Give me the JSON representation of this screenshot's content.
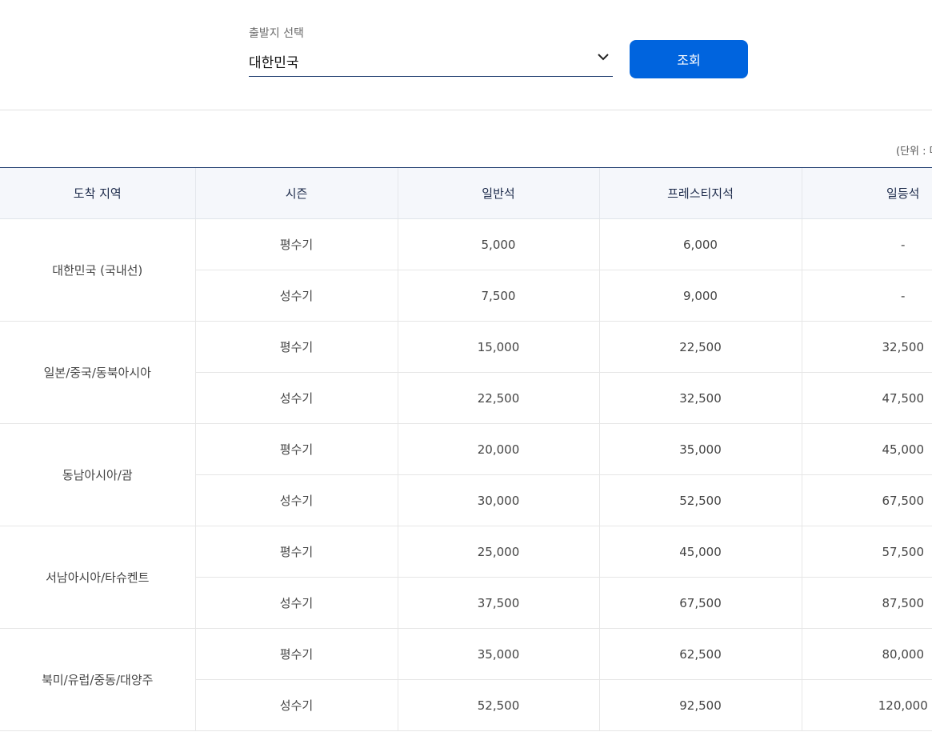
{
  "search": {
    "label": "출발지 선택",
    "selected": "대한민국",
    "button_label": "조회"
  },
  "unit_note": "(단위 : 마",
  "table": {
    "headers": [
      "도착 지역",
      "시즌",
      "일반석",
      "프레스티지석",
      "일등석"
    ],
    "regions": [
      {
        "name": "대한민국 (국내선)",
        "rows": [
          {
            "season": "평수기",
            "economy": "5,000",
            "prestige": "6,000",
            "first": "-"
          },
          {
            "season": "성수기",
            "economy": "7,500",
            "prestige": "9,000",
            "first": "-"
          }
        ]
      },
      {
        "name": "일본/중국/동북아시아",
        "rows": [
          {
            "season": "평수기",
            "economy": "15,000",
            "prestige": "22,500",
            "first": "32,500"
          },
          {
            "season": "성수기",
            "economy": "22,500",
            "prestige": "32,500",
            "first": "47,500"
          }
        ]
      },
      {
        "name": "동남아시아/괌",
        "rows": [
          {
            "season": "평수기",
            "economy": "20,000",
            "prestige": "35,000",
            "first": "45,000"
          },
          {
            "season": "성수기",
            "economy": "30,000",
            "prestige": "52,500",
            "first": "67,500"
          }
        ]
      },
      {
        "name": "서남아시아/타슈켄트",
        "rows": [
          {
            "season": "평수기",
            "economy": "25,000",
            "prestige": "45,000",
            "first": "57,500"
          },
          {
            "season": "성수기",
            "economy": "37,500",
            "prestige": "67,500",
            "first": "87,500"
          }
        ]
      },
      {
        "name": "북미/유럽/중동/대양주",
        "rows": [
          {
            "season": "평수기",
            "economy": "35,000",
            "prestige": "62,500",
            "first": "80,000"
          },
          {
            "season": "성수기",
            "economy": "52,500",
            "prestige": "92,500",
            "first": "120,000"
          }
        ]
      }
    ]
  },
  "colors": {
    "accent": "#0064de",
    "header_bg": "#f5f7fb",
    "header_text": "#1c2a4a",
    "select_line": "#1d3a6e"
  }
}
